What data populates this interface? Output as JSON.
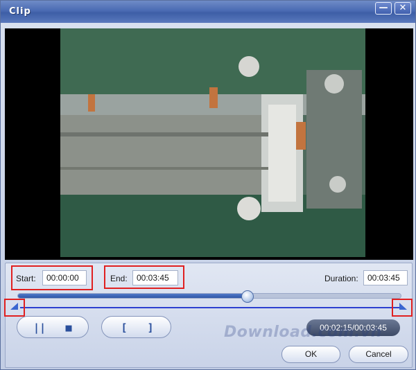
{
  "window": {
    "title": "Clip"
  },
  "titlebar_buttons": {
    "minimize": "—",
    "close": "✕"
  },
  "fields": {
    "start_label": "Start:",
    "start_value": "00:00:00",
    "end_label": "End:",
    "end_value": "00:03:45",
    "duration_label": "Duration:",
    "duration_value": "00:03:45"
  },
  "playback": {
    "progress_fraction": 0.6,
    "current_time": "00:02:15/00:03:45"
  },
  "controls": {
    "pause_icon": "pause-icon",
    "stop_icon": "stop-icon",
    "mark_in_icon": "mark-in-icon",
    "mark_out_icon": "mark-out-icon",
    "pause_glyph": "||",
    "stop_glyph": "■",
    "mark_in_glyph": "[",
    "mark_out_glyph": "]"
  },
  "actions": {
    "ok_label": "OK",
    "cancel_label": "Cancel"
  },
  "watermark": "Download.com.vn",
  "colors": {
    "accent": "#2c3fd0",
    "highlight_red": "#e02020",
    "title_bar": "#4a6bb3"
  }
}
